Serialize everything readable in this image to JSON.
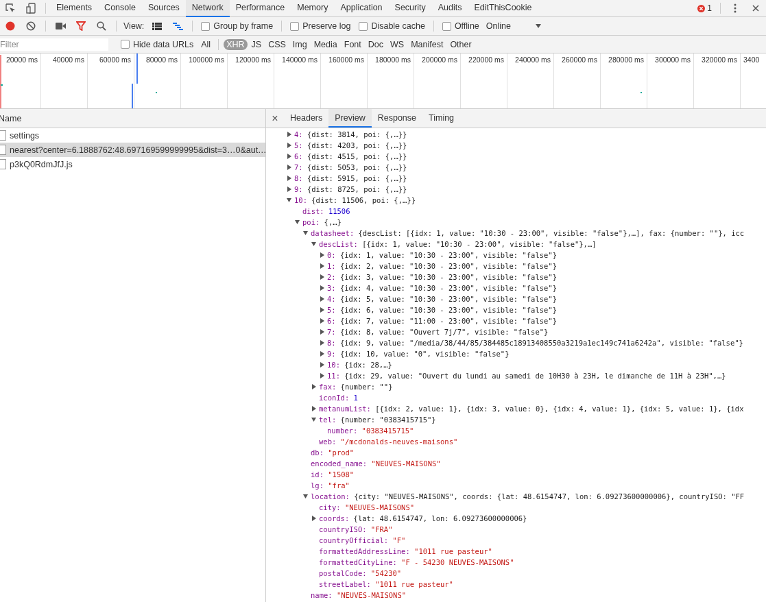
{
  "main_tabs": [
    {
      "label": "Elements",
      "selected": false
    },
    {
      "label": "Console",
      "selected": false
    },
    {
      "label": "Sources",
      "selected": false
    },
    {
      "label": "Network",
      "selected": true
    },
    {
      "label": "Performance",
      "selected": false
    },
    {
      "label": "Memory",
      "selected": false
    },
    {
      "label": "Application",
      "selected": false
    },
    {
      "label": "Security",
      "selected": false
    },
    {
      "label": "Audits",
      "selected": false
    },
    {
      "label": "EditThisCookie",
      "selected": false
    }
  ],
  "error_count": "1",
  "toolbar": {
    "recording": true,
    "filter_active": true,
    "view_label": "View:",
    "view_modes": [
      {
        "kind": "list",
        "selected": false
      },
      {
        "kind": "waterfall",
        "selected": true
      }
    ],
    "options": [
      {
        "label": "Group by frame",
        "checked": false
      },
      {
        "label": "Preserve log",
        "checked": false
      },
      {
        "label": "Disable cache",
        "checked": false
      },
      {
        "label": "Offline",
        "checked": false
      }
    ],
    "throttling": "Online"
  },
  "filter_bar": {
    "placeholder": "Filter",
    "hide_data_urls": {
      "label": "Hide data URLs",
      "checked": false
    },
    "types": [
      {
        "label": "All",
        "selected": false
      },
      {
        "label": "XHR",
        "selected": true
      },
      {
        "label": "JS",
        "selected": false
      },
      {
        "label": "CSS",
        "selected": false
      },
      {
        "label": "Img",
        "selected": false
      },
      {
        "label": "Media",
        "selected": false
      },
      {
        "label": "Font",
        "selected": false
      },
      {
        "label": "Doc",
        "selected": false
      },
      {
        "label": "WS",
        "selected": false
      },
      {
        "label": "Manifest",
        "selected": false
      },
      {
        "label": "Other",
        "selected": false
      }
    ]
  },
  "timeline": {
    "ticks": [
      "20000 ms",
      "40000 ms",
      "60000 ms",
      "80000 ms",
      "100000 ms",
      "120000 ms",
      "140000 ms",
      "160000 ms",
      "180000 ms",
      "200000 ms",
      "220000 ms",
      "240000 ms",
      "260000 ms",
      "280000 ms",
      "300000 ms",
      "320000 ms",
      "3400"
    ]
  },
  "requests": {
    "header": "Name",
    "rows": [
      {
        "name": "settings",
        "selected": false
      },
      {
        "name": "nearest?center=6.1888762:48.697169599999995&dist=3…0&aut…",
        "selected": true
      },
      {
        "name": "p3kQ0RdmJfJ.js",
        "selected": false
      }
    ]
  },
  "details": {
    "close": "×",
    "tabs": [
      {
        "label": "Headers",
        "selected": false
      },
      {
        "label": "Preview",
        "selected": true
      },
      {
        "label": "Response",
        "selected": false
      },
      {
        "label": "Timing",
        "selected": false
      }
    ],
    "preview": [
      {
        "key": "4:",
        "value": "{dist: 3814, poi: {,…}}",
        "kind": "object",
        "expanded": false
      },
      {
        "key": "5:",
        "value": "{dist: 4203, poi: {,…}}",
        "kind": "object",
        "expanded": false
      },
      {
        "key": "6:",
        "value": "{dist: 4515, poi: {,…}}",
        "kind": "object",
        "expanded": false
      },
      {
        "key": "7:",
        "value": "{dist: 5053, poi: {,…}}",
        "kind": "object",
        "expanded": false
      },
      {
        "key": "8:",
        "value": "{dist: 5915, poi: {,…}}",
        "kind": "object",
        "expanded": false
      },
      {
        "key": "9:",
        "value": "{dist: 8725, poi: {,…}}",
        "kind": "object",
        "expanded": false
      },
      {
        "key": "10:",
        "value": "{dist: 11506, poi: {,…}}",
        "kind": "object",
        "expanded": true,
        "children": [
          {
            "key": "dist:",
            "value": "11506",
            "kind": "number"
          },
          {
            "key": "poi:",
            "value": "{,…}",
            "kind": "object",
            "expanded": true,
            "children": [
              {
                "key": "datasheet:",
                "value": "{descList: [{idx: 1, value: \"10:30 - 23:00\", visible: \"false\"},…], fax: {number: \"\"}, icc",
                "kind": "object",
                "expanded": true,
                "children": [
                  {
                    "key": "descList:",
                    "value": "[{idx: 1, value: \"10:30 - 23:00\", visible: \"false\"},…]",
                    "kind": "object",
                    "expanded": true,
                    "children": [
                      {
                        "key": "0:",
                        "value": "{idx: 1, value: \"10:30 - 23:00\", visible: \"false\"}",
                        "kind": "object",
                        "expanded": false
                      },
                      {
                        "key": "1:",
                        "value": "{idx: 2, value: \"10:30 - 23:00\", visible: \"false\"}",
                        "kind": "object",
                        "expanded": false
                      },
                      {
                        "key": "2:",
                        "value": "{idx: 3, value: \"10:30 - 23:00\", visible: \"false\"}",
                        "kind": "object",
                        "expanded": false
                      },
                      {
                        "key": "3:",
                        "value": "{idx: 4, value: \"10:30 - 23:00\", visible: \"false\"}",
                        "kind": "object",
                        "expanded": false
                      },
                      {
                        "key": "4:",
                        "value": "{idx: 5, value: \"10:30 - 23:00\", visible: \"false\"}",
                        "kind": "object",
                        "expanded": false
                      },
                      {
                        "key": "5:",
                        "value": "{idx: 6, value: \"10:30 - 23:00\", visible: \"false\"}",
                        "kind": "object",
                        "expanded": false
                      },
                      {
                        "key": "6:",
                        "value": "{idx: 7, value: \"11:00 - 23:00\", visible: \"false\"}",
                        "kind": "object",
                        "expanded": false
                      },
                      {
                        "key": "7:",
                        "value": "{idx: 8, value: \"Ouvert 7j/7\", visible: \"false\"}",
                        "kind": "object",
                        "expanded": false
                      },
                      {
                        "key": "8:",
                        "value": "{idx: 9, value: \"/media/38/44/85/384485c18913408550a3219a1ec149c741a6242a\", visible: \"false\"}",
                        "kind": "object",
                        "expanded": false
                      },
                      {
                        "key": "9:",
                        "value": "{idx: 10, value: \"0\", visible: \"false\"}",
                        "kind": "object",
                        "expanded": false
                      },
                      {
                        "key": "10:",
                        "value": "{idx: 28,…}",
                        "kind": "object",
                        "expanded": false
                      },
                      {
                        "key": "11:",
                        "value": "{idx: 29, value: \"Ouvert du lundi au samedi de 10H30 à 23H, le dimanche de 11H à 23H\",…}",
                        "kind": "object",
                        "expanded": false
                      }
                    ]
                  },
                  {
                    "key": "fax:",
                    "value": "{number: \"\"}",
                    "kind": "object",
                    "expanded": false
                  },
                  {
                    "key": "iconId:",
                    "value": "1",
                    "kind": "number"
                  },
                  {
                    "key": "metanumList:",
                    "value": "[{idx: 2, value: 1}, {idx: 3, value: 0}, {idx: 4, value: 1}, {idx: 5, value: 1}, {idx",
                    "kind": "object",
                    "expanded": false
                  },
                  {
                    "key": "tel:",
                    "value": "{number: \"0383415715\"}",
                    "kind": "object",
                    "expanded": true,
                    "children": [
                      {
                        "key": "number:",
                        "value": "\"0383415715\"",
                        "kind": "string"
                      }
                    ]
                  },
                  {
                    "key": "web:",
                    "value": "\"/mcdonalds-neuves-maisons\"",
                    "kind": "string"
                  }
                ]
              },
              {
                "key": "db:",
                "value": "\"prod\"",
                "kind": "string"
              },
              {
                "key": "encoded_name:",
                "value": "\"NEUVES-MAISONS\"",
                "kind": "string"
              },
              {
                "key": "id:",
                "value": "\"1508\"",
                "kind": "string"
              },
              {
                "key": "lg:",
                "value": "\"fra\"",
                "kind": "string"
              },
              {
                "key": "location:",
                "value": "{city: \"NEUVES-MAISONS\", coords: {lat: 48.6154747, lon: 6.09273600000006}, countryISO: \"FF",
                "kind": "object",
                "expanded": true,
                "children": [
                  {
                    "key": "city:",
                    "value": "\"NEUVES-MAISONS\"",
                    "kind": "string"
                  },
                  {
                    "key": "coords:",
                    "value": "{lat: 48.6154747, lon: 6.09273600000006}",
                    "kind": "object",
                    "expanded": false
                  },
                  {
                    "key": "countryISO:",
                    "value": "\"FRA\"",
                    "kind": "string"
                  },
                  {
                    "key": "countryOfficial:",
                    "value": "\"F\"",
                    "kind": "string"
                  },
                  {
                    "key": "formattedAddressLine:",
                    "value": "\"1011 rue pasteur\"",
                    "kind": "string"
                  },
                  {
                    "key": "formattedCityLine:",
                    "value": "\"F - 54230 NEUVES-MAISONS\"",
                    "kind": "string"
                  },
                  {
                    "key": "postalCode:",
                    "value": "\"54230\"",
                    "kind": "string"
                  },
                  {
                    "key": "streetLabel:",
                    "value": "\"1011 rue pasteur\"",
                    "kind": "string"
                  }
                ]
              },
              {
                "key": "name:",
                "value": "\"NEUVES-MAISONS\"",
                "kind": "string"
              }
            ]
          }
        ]
      }
    ]
  }
}
